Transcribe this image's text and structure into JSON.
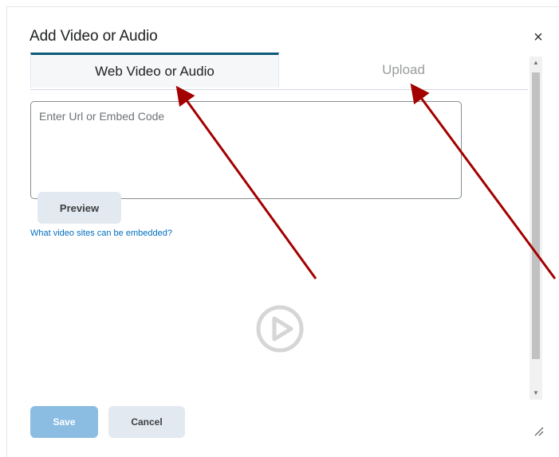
{
  "dialog": {
    "title": "Add Video or Audio",
    "close_glyph": "×"
  },
  "tabs": [
    {
      "label": "Web Video or Audio",
      "active": true
    },
    {
      "label": "Upload",
      "active": false
    }
  ],
  "form": {
    "url_placeholder": "Enter Url or Embed Code",
    "url_value": "",
    "preview_label": "Preview",
    "embed_link_label": "What video sites can be embedded?"
  },
  "media_preview": {
    "icon": "play-circle-icon"
  },
  "footer": {
    "save_label": "Save",
    "cancel_label": "Cancel"
  },
  "scrollbar": {
    "up_glyph": "▲",
    "down_glyph": "▼"
  },
  "colors": {
    "active_tab_border": "#0b5a78",
    "link": "#006fbf",
    "save_button": "#8bbde3",
    "secondary_button": "#e3e9f1",
    "annotation_arrow": "#a30000"
  }
}
